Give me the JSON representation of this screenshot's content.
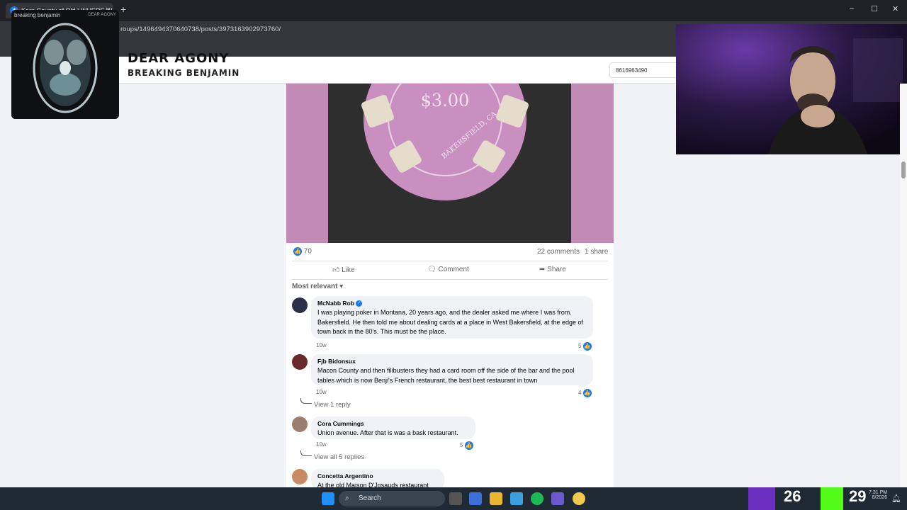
{
  "browser": {
    "tab_title": "Kern County of Old | WHERE W...",
    "tab_close": "×",
    "new_tab": "+",
    "url": "roups/1496494370640738/posts/3973163902973760/",
    "window_controls": [
      "–",
      "☐",
      "✕"
    ]
  },
  "now_playing": {
    "album_label_left": "breaking benjamin",
    "album_label_right": "DEAR AGONY",
    "song_title": "DEAR AGONY",
    "artist": "BREAKING BENJAMIN"
  },
  "search": {
    "value": "8616963490"
  },
  "post": {
    "photo_chip_value": "$3.00",
    "photo_chip_text": "BAKERSFIELD, CA",
    "reaction_count": "70",
    "comments_count": "22 comments",
    "shares_count": "1 share",
    "actions": {
      "like": "Like",
      "comment": "Comment",
      "share": "Share"
    },
    "sort_label": "Most relevant"
  },
  "comments": [
    {
      "name": "McNabb Rob",
      "verified": true,
      "text": "I was playing poker in Montana, 20 years ago, and the dealer asked me where I was from. Bakersfield. He then told me about dealing cards at a place in West Bakersfield, at the edge of town back in the 80's. This must be the place.",
      "time": "10w",
      "reactions": "5"
    },
    {
      "name": "Fjb Bidonsux",
      "text": "Macon County and then filibusters they had a card room off the side of the bar and the pool tables which is now Benji's French restaurant, the best best restaurant in town",
      "time": "10w",
      "reactions": "4",
      "replies": "View 1 reply"
    },
    {
      "name": "Cora Cummings",
      "text": "Union avenue. After that is was a bask restaurant.",
      "time": "10w",
      "reactions": "5",
      "replies": "View all 5 replies"
    },
    {
      "name": "Concetta Argentino",
      "text": "At the old Maison D'Josauds restaurant"
    }
  ],
  "taskbar": {
    "search_label": "Search",
    "overlay_left": "26",
    "overlay_right": "29",
    "time": "7:31 PM",
    "date": "8/2026"
  },
  "colors": {
    "fb_blue": "#1877f2",
    "taskbar": "#1f2a35",
    "chrome": "#35363a"
  }
}
